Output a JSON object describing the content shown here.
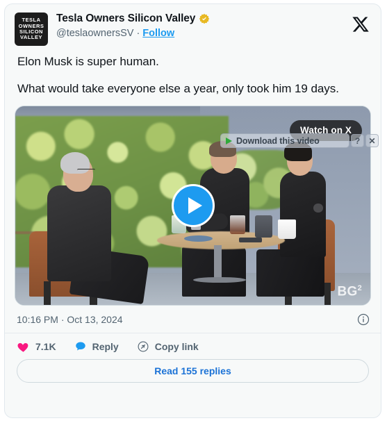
{
  "card": {
    "accent_blue": "#1d9bf0",
    "link_blue": "#1b72d6",
    "heart_pink": "#f91880",
    "text_color": "#0f1419",
    "muted_color": "#536471",
    "background": "#f7f9f9"
  },
  "header": {
    "avatar_lines": [
      "TESLA",
      "OWNERS",
      "SILICON",
      "VALLEY"
    ],
    "display_name": "Tesla Owners Silicon Valley",
    "verified_badge_icon": "verified-gold-badge-icon",
    "handle": "@teslaownersSV",
    "separator": "·",
    "follow_label": "Follow",
    "x_logo_icon": "x-logo-icon"
  },
  "tweet": {
    "paragraphs": [
      "Elon Musk is super human.",
      "What would take everyone else a year, only took him 19 days."
    ]
  },
  "media": {
    "play_button_icon": "play-triangle-icon",
    "watch_on_x_label": "Watch on X",
    "watermark": "BG",
    "watermark_sup": "2"
  },
  "download_overlay": {
    "play_icon": "green-play-triangle-icon",
    "label": "Download this video",
    "help_label": "?",
    "close_label": "✕"
  },
  "meta": {
    "timestamp": "10:16 PM · Oct 13, 2024",
    "info_icon": "info-circle-icon"
  },
  "actions": {
    "like": {
      "icon": "heart-icon",
      "count": "7.1K"
    },
    "reply": {
      "icon": "speech-bubble-icon",
      "label": "Reply"
    },
    "copy_link": {
      "icon": "link-icon",
      "label": "Copy link"
    }
  },
  "footer": {
    "read_replies_label": "Read 155 replies"
  }
}
